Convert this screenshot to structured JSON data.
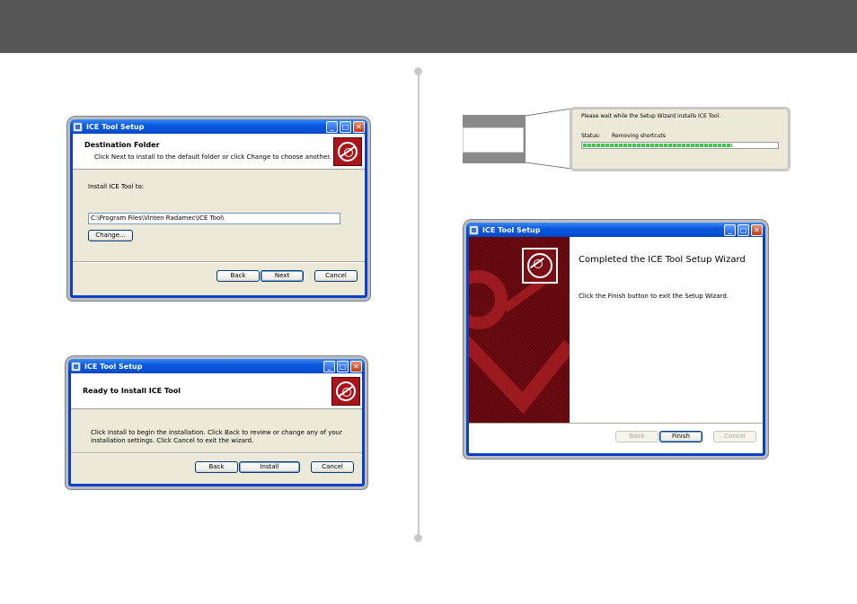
{
  "dialog_destination": {
    "title": "ICE Tool Setup",
    "heading": "Destination Folder",
    "subheading": "Click Next to install to the default folder or click Change to choose another.",
    "install_label": "Install ICE Tool to:",
    "path_value": "C:\\Program Files\\Vinten Radamec\\ICE Tool\\",
    "change_button": "Change...",
    "back_button": "Back",
    "next_button": "Next",
    "cancel_button": "Cancel"
  },
  "dialog_ready": {
    "title": "ICE Tool Setup",
    "heading": "Ready to Install ICE Tool",
    "body_line1": "Click Install to begin the installation. Click Back to review or change any of your",
    "body_line2": "installation settings. Click Cancel to exit the wizard.",
    "back_button": "Back",
    "install_button": "Install",
    "cancel_button": "Cancel"
  },
  "progress_panel": {
    "message": "Please wait while the Setup Wizard installs ICE Tool.",
    "status_label": "Status:",
    "status_value": "Removing shortcuts",
    "progress_fraction": 0.77
  },
  "dialog_complete": {
    "title": "ICE Tool Setup",
    "heading": "Completed the ICE Tool Setup Wizard",
    "body": "Click the Finish button to exit the Setup Wizard.",
    "back_button": "Back",
    "finish_button": "Finish",
    "cancel_button": "Cancel"
  },
  "titlebar_buttons": {
    "minimize": "_",
    "maximize": "□",
    "close": "✕"
  },
  "icons": {
    "logo": "ice-tool-disc-logo-icon",
    "window": "installer-window-icon"
  },
  "colors": {
    "header": "#565656",
    "xp_blue": "#0a5bdf",
    "logo_red": "#a8141a",
    "progress_green": "#3bc94a"
  }
}
